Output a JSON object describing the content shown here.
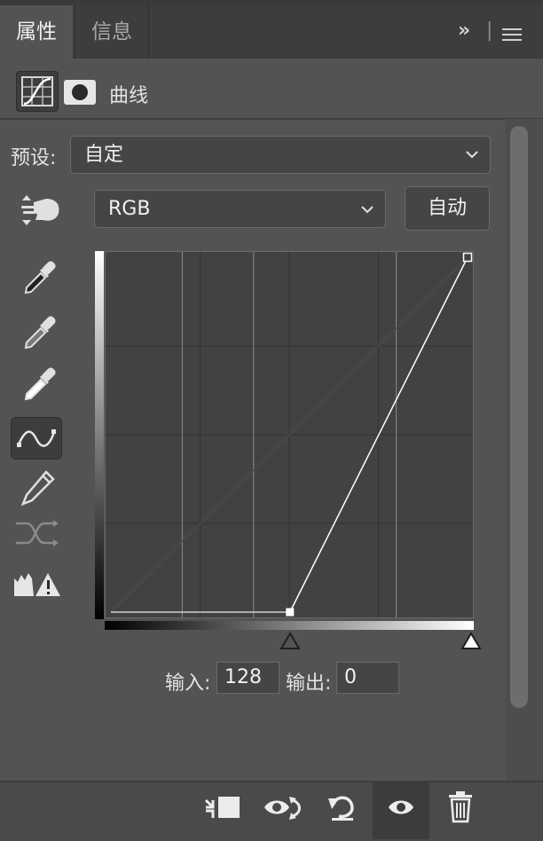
{
  "tabs": [
    {
      "label": "属性",
      "active": true
    },
    {
      "label": "信息",
      "active": false
    }
  ],
  "panel_controls": {
    "collapse": "»",
    "divider": "|"
  },
  "header": {
    "title": "曲线",
    "icons": [
      "curves-adjustment-icon",
      "mask-icon"
    ]
  },
  "preset": {
    "label": "预设:",
    "value": "自定"
  },
  "channel": {
    "value": "RGB"
  },
  "auto_button": {
    "label": "自动"
  },
  "tools": [
    "on-image-adjust-icon",
    "black-point-eyedropper-icon",
    "gray-point-eyedropper-icon",
    "white-point-eyedropper-icon",
    "edit-points-curve-icon",
    "draw-pencil-icon",
    "smooth-curve-icon",
    "clipping-warning-icon"
  ],
  "curve": {
    "points": [
      {
        "input": 128,
        "output": 0
      },
      {
        "input": 255,
        "output": 255
      }
    ],
    "input_range": [
      0,
      255
    ],
    "output_range": [
      0,
      255
    ],
    "sliders": {
      "black_input": 128,
      "white_input": 255
    }
  },
  "io": {
    "input_label": "输入:",
    "input_value": "128",
    "output_label": "输出:",
    "output_value": "0"
  },
  "footer_icons": [
    "clip-to-layer-icon",
    "view-previous-icon",
    "reset-icon",
    "visibility-eye-icon",
    "delete-trash-icon"
  ],
  "colors": {
    "panel_bg": "#535353",
    "tab_bar_bg": "#3d3d3d",
    "field_bg": "#454545",
    "graph_bg": "#424242"
  }
}
